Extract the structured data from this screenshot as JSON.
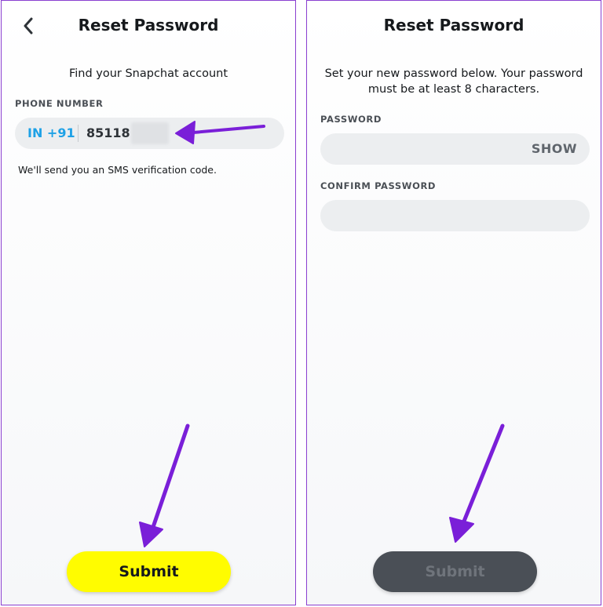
{
  "left_screen": {
    "title": "Reset Password",
    "subtitle": "Find your Snapchat account",
    "phone_label": "PHONE NUMBER",
    "country_code": "IN +91",
    "phone_value": "85118",
    "hint": "We'll send you an SMS verification code.",
    "submit_label": "Submit"
  },
  "right_screen": {
    "title": "Reset Password",
    "subtitle_line1": "Set your new password below. Your password",
    "subtitle_line2": "must be at least 8 characters.",
    "password_label": "PASSWORD",
    "show_label": "SHOW",
    "confirm_label": "CONFIRM PASSWORD",
    "submit_label": "Submit"
  },
  "colors": {
    "accent_yellow": "#fffc00",
    "country_blue": "#1ea1e6",
    "annotation_purple": "#7a1fd8",
    "disabled_button": "#4a4f56"
  },
  "icons": {
    "back": "chevron-left-icon",
    "annotation": "arrow-annotation-icon"
  }
}
